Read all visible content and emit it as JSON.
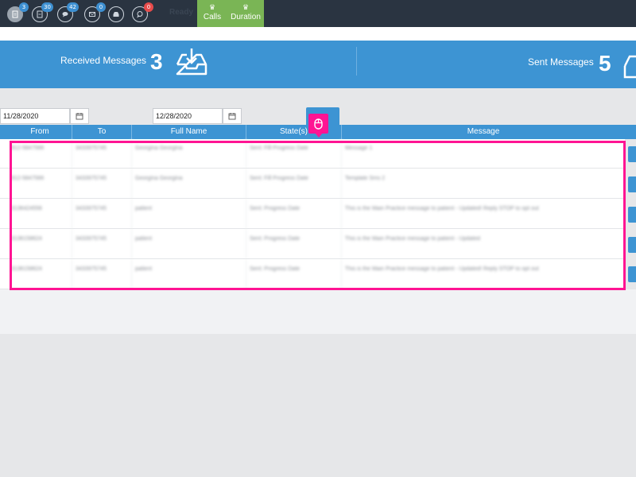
{
  "topbar": {
    "icons": [
      {
        "name": "document-icon",
        "badge": "3"
      },
      {
        "name": "file-icon",
        "badge": "30"
      },
      {
        "name": "chat-icon",
        "badge": "42"
      },
      {
        "name": "mail-icon",
        "badge": "0"
      },
      {
        "name": "inbox-tray-icon",
        "badge": ""
      },
      {
        "name": "comment-icon",
        "badge": "0"
      }
    ],
    "status": "Ready",
    "tabs": [
      {
        "label": "Calls",
        "icon": "crown-icon"
      },
      {
        "label": "Duration",
        "icon": "crown-icon"
      }
    ]
  },
  "stats": {
    "received_label": "Received Messages",
    "received_value": "3",
    "sent_label": "Sent Messages",
    "sent_value": "5"
  },
  "filters": {
    "from_date": "11/28/2020",
    "to_date": "12/28/2020"
  },
  "table": {
    "headers": [
      "From",
      "To",
      "Full Name",
      "State(s)",
      "Message"
    ],
    "rows": [
      [
        "912-5847566",
        "3433975745",
        "Georgina Georgina",
        "Sent: Fill Progress Date",
        "Message 1"
      ],
      [
        "912-5847566",
        "3433975745",
        "Georgina Georgina",
        "Sent: Fill Progress Date",
        "Template Sms 2"
      ],
      [
        "3136424556",
        "3433975745",
        "patient",
        "Sent: Progress Date",
        "This is the Main Practice message to patient - Updated! Reply STOP to opt out"
      ],
      [
        "3136158624",
        "3433975745",
        "patient",
        "Sent: Progress Date",
        "This is the Main Practice message to patient - Updated"
      ],
      [
        "3136158624",
        "3433975745",
        "patient",
        "Sent: Progress Date",
        "This is the Main Practice message to patient - Updated! Reply STOP to opt out"
      ]
    ]
  },
  "colors": {
    "topbar": "#2a3441",
    "accent": "#3d94d3",
    "green": "#7ab555",
    "highlight": "#ff1493"
  }
}
